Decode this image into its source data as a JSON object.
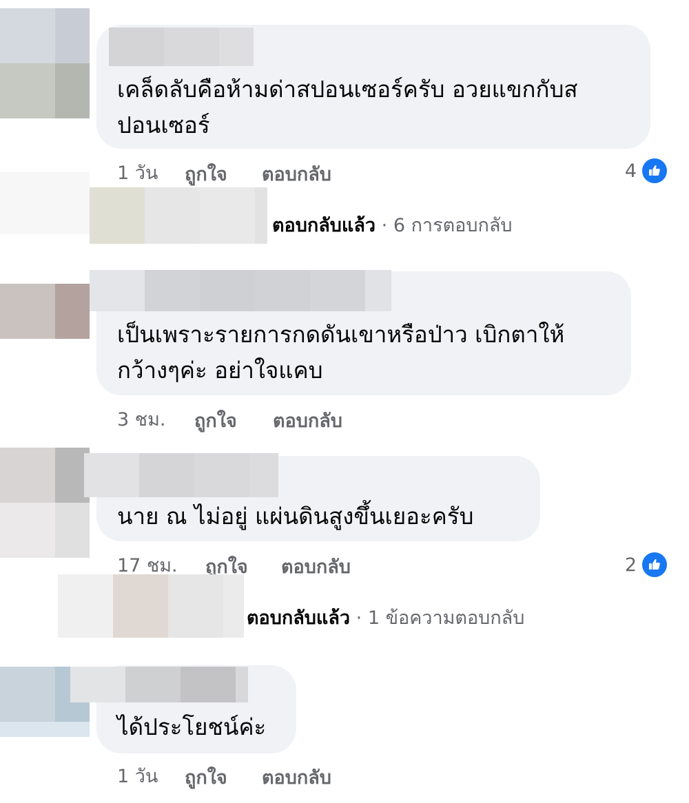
{
  "comments": [
    {
      "text_lines": [
        "เคล็ดลับคือห้ามด่าสปอนเซอร์ครับ อวยแขกกับส",
        "ปอนเซอร์"
      ],
      "time": "1 วัน",
      "like_label": "ถูกใจ",
      "reply_label": "ตอบกลับ",
      "reaction_count": "4",
      "replies": {
        "label": "ตอบกลับแล้ว",
        "separator": "·",
        "count": "6 การตอบกลับ"
      }
    },
    {
      "text_lines": [
        "เป็นเพราะรายการกดดันเขาหรือป่าว เบิกตาให้",
        "กว้างๆค่ะ อย่าใจแคบ"
      ],
      "time": "3 ชม.",
      "like_label": "ถูกใจ",
      "reply_label": "ตอบกลับ"
    },
    {
      "text_lines": [
        "นาย ณ   ไม่อยู่ แผ่นดินสูงขึ้นเยอะครับ"
      ],
      "time": "17 ชม.",
      "like_label": "ถูกใจ",
      "reply_label": "ตอบกลับ",
      "reaction_count": "2",
      "replies": {
        "label": "ตอบกลับแล้ว",
        "separator": "·",
        "count": "1 ข้อความตอบกลับ"
      }
    },
    {
      "text_lines": [
        "ได้ประโยชน์ค่ะ"
      ],
      "time": "1 วัน",
      "like_label": "ถูกใจ",
      "reply_label": "ตอบกลับ"
    }
  ],
  "icons": {
    "reaction": "like-thumb-icon",
    "avatar": "blurred-avatar"
  },
  "colors": {
    "bubble": "#f0f2f5",
    "meta_text": "#65676b",
    "like_blue": "#1877f2",
    "text": "#050505"
  }
}
